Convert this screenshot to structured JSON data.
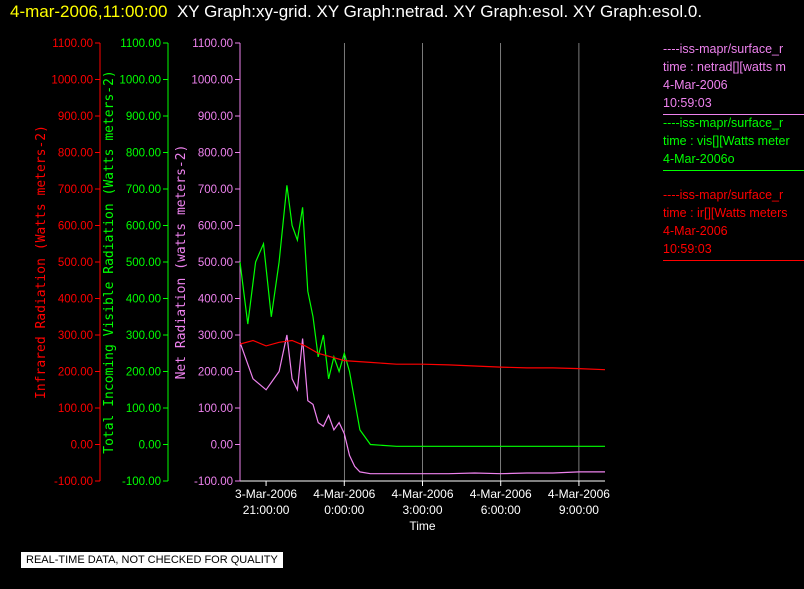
{
  "header": {
    "timestamp": "4-mar-2006,11:00:00",
    "views": "XY Graph:xy-grid.  XY Graph:netrad.  XY Graph:esol.  XY Graph:esol.0."
  },
  "colors": {
    "infrared": "#ff0000",
    "visible": "#00ff00",
    "net": "#ee82ee",
    "grid": "#ffffff",
    "header_time": "#ffff00"
  },
  "chart_data": {
    "type": "line",
    "xlabel": "Time",
    "x_ticks": [
      {
        "t": -2,
        "line1": "3-Mar-2006",
        "line2": "21:00:00"
      },
      {
        "t": 1,
        "line1": "4-Mar-2006",
        "line2": "0:00:00"
      },
      {
        "t": 4,
        "line1": "4-Mar-2006",
        "line2": "3:00:00"
      },
      {
        "t": 7,
        "line1": "4-Mar-2006",
        "line2": "6:00:00"
      },
      {
        "t": 10,
        "line1": "4-Mar-2006",
        "line2": "9:00:00"
      }
    ],
    "xlim_hours_from_midnight": [
      -3,
      11.0
    ],
    "grid": "vertical",
    "axes": [
      {
        "id": "infrared",
        "label": "Infrared Radiation (Watts meters-2)",
        "color": "#ff0000",
        "ylim": [
          -100,
          1100
        ],
        "ticks": [
          "-100.00",
          "0.00",
          "100.00",
          "200.00",
          "300.00",
          "400.00",
          "500.00",
          "600.00",
          "700.00",
          "800.00",
          "900.00",
          "1000.00",
          "1100.00"
        ]
      },
      {
        "id": "visible",
        "label": "Total Incoming Visible Radiation (Watts meters-2)",
        "color": "#00ff00",
        "ylim": [
          -100,
          1100
        ],
        "ticks": [
          "-100.00",
          "0.00",
          "100.00",
          "200.00",
          "300.00",
          "400.00",
          "500.00",
          "600.00",
          "700.00",
          "800.00",
          "900.00",
          "1000.00",
          "1100.00"
        ]
      },
      {
        "id": "net",
        "label": "Net Radiation (watts meters-2)",
        "color": "#ee82ee",
        "ylim": [
          -100,
          1100
        ],
        "ticks": [
          "-100.00",
          "0.00",
          "100.00",
          "200.00",
          "300.00",
          "400.00",
          "500.00",
          "600.00",
          "700.00",
          "800.00",
          "900.00",
          "1000.00",
          "1100.00"
        ]
      }
    ],
    "series": [
      {
        "name": "netrad",
        "axis": "net",
        "x": [
          -3,
          -2.5,
          -2.0,
          -1.5,
          -1.2,
          -1.0,
          -0.8,
          -0.6,
          -0.4,
          -0.2,
          0.0,
          0.2,
          0.4,
          0.6,
          0.8,
          1.0,
          1.2,
          1.4,
          1.6,
          2.0,
          3.0,
          4.0,
          5.0,
          6.0,
          7.0,
          8.0,
          9.0,
          10.0,
          11.0
        ],
        "y": [
          280,
          180,
          150,
          200,
          300,
          180,
          150,
          290,
          120,
          110,
          60,
          50,
          80,
          40,
          60,
          30,
          -30,
          -60,
          -75,
          -80,
          -80,
          -80,
          -80,
          -78,
          -80,
          -78,
          -78,
          -75,
          -75
        ]
      },
      {
        "name": "vis",
        "axis": "visible",
        "x": [
          -3,
          -2.7,
          -2.4,
          -2.1,
          -1.8,
          -1.5,
          -1.2,
          -1.0,
          -0.8,
          -0.6,
          -0.4,
          -0.2,
          0.0,
          0.2,
          0.4,
          0.6,
          0.8,
          1.0,
          1.2,
          1.4,
          1.6,
          2.0,
          3.0,
          4.0,
          5.0,
          6.0,
          7.0,
          8.0,
          9.0,
          10.0,
          11.0
        ],
        "y": [
          500,
          330,
          500,
          550,
          350,
          500,
          710,
          600,
          560,
          650,
          420,
          350,
          240,
          300,
          180,
          240,
          200,
          250,
          200,
          120,
          40,
          0,
          -5,
          -5,
          -5,
          -5,
          -5,
          -5,
          -5,
          -5,
          -5
        ]
      },
      {
        "name": "ir",
        "axis": "infrared",
        "x": [
          -3,
          -2.5,
          -2.0,
          -1.5,
          -1.0,
          -0.5,
          0.0,
          0.5,
          1.0,
          2.0,
          3.0,
          4.0,
          5.0,
          6.0,
          7.0,
          8.0,
          9.0,
          10.0,
          11.0
        ],
        "y": [
          275,
          285,
          270,
          280,
          285,
          270,
          250,
          240,
          230,
          225,
          220,
          220,
          218,
          215,
          212,
          210,
          210,
          208,
          205
        ]
      }
    ]
  },
  "legend": [
    {
      "lines": [
        "----iss-mapr/surface_r",
        "time : netrad[][watts m",
        "4-Mar-2006",
        "10:59:03"
      ],
      "color": "#ee82ee"
    },
    {
      "lines": [
        "----iss-mapr/surface_r",
        "time : vis[][Watts meter",
        "4-Mar-2006o"
      ],
      "color": "#00ff00"
    },
    {
      "lines": [
        "----iss-mapr/surface_r",
        "time : ir[][Watts meters",
        "4-Mar-2006",
        "10:59:03"
      ],
      "color": "#ff0000"
    }
  ],
  "footer_note": "REAL-TIME DATA, NOT CHECKED FOR QUALITY"
}
